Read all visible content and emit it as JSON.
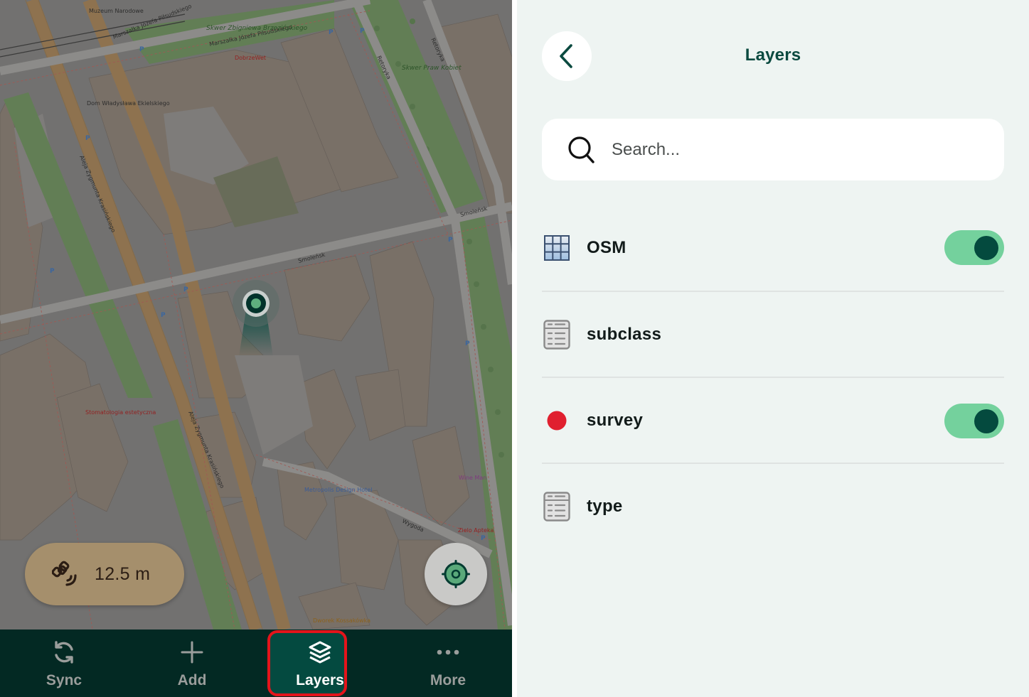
{
  "map": {
    "street_labels": [
      "Marszałka Józefa Piłsudskiego",
      "Aleja Zygmunta Krasińskiego",
      "Smoleńsk",
      "Retoryka",
      "Wygoda"
    ],
    "place_labels": [
      "Muzeum Narodowe",
      "Skwer Zbigniewa Brzezińskiego",
      "Skwer Praw Kobiet",
      "Dom Władysława Ekielskiego",
      "Metropolis Design Hotel",
      "Zielo Apteka",
      "Wine Man",
      "Dworek Kossakówka",
      "DobrzeWet",
      "Stomatologia estetyczna"
    ],
    "accuracy": {
      "icon": "satellite-icon",
      "value": "12.5 m"
    },
    "locate_button": {
      "icon": "gps-crosshair-icon"
    }
  },
  "bottom_nav": {
    "items": [
      {
        "label": "Sync",
        "icon": "sync-icon",
        "active": false
      },
      {
        "label": "Add",
        "icon": "plus-icon",
        "active": false
      },
      {
        "label": "Layers",
        "icon": "layers-icon",
        "active": true
      },
      {
        "label": "More",
        "icon": "more-dots-icon",
        "active": false
      }
    ],
    "highlight_color": "#e4141b"
  },
  "panel": {
    "title": "Layers",
    "back_icon": "chevron-left-icon",
    "search": {
      "placeholder": "Search...",
      "value": ""
    },
    "layers": [
      {
        "name": "OSM",
        "icon": "raster-grid-icon",
        "has_toggle": true,
        "visible": true
      },
      {
        "name": "subclass",
        "icon": "table-icon",
        "has_toggle": false
      },
      {
        "name": "survey",
        "icon": "point-layer-icon",
        "icon_color": "#e0202f",
        "has_toggle": true,
        "visible": true
      },
      {
        "name": "type",
        "icon": "table-icon",
        "has_toggle": false
      }
    ]
  },
  "colors": {
    "accent_dark": "#044a3e",
    "toggle_on": "#74d19d",
    "nav_bg": "#032923",
    "panel_bg": "#eef4f2"
  }
}
